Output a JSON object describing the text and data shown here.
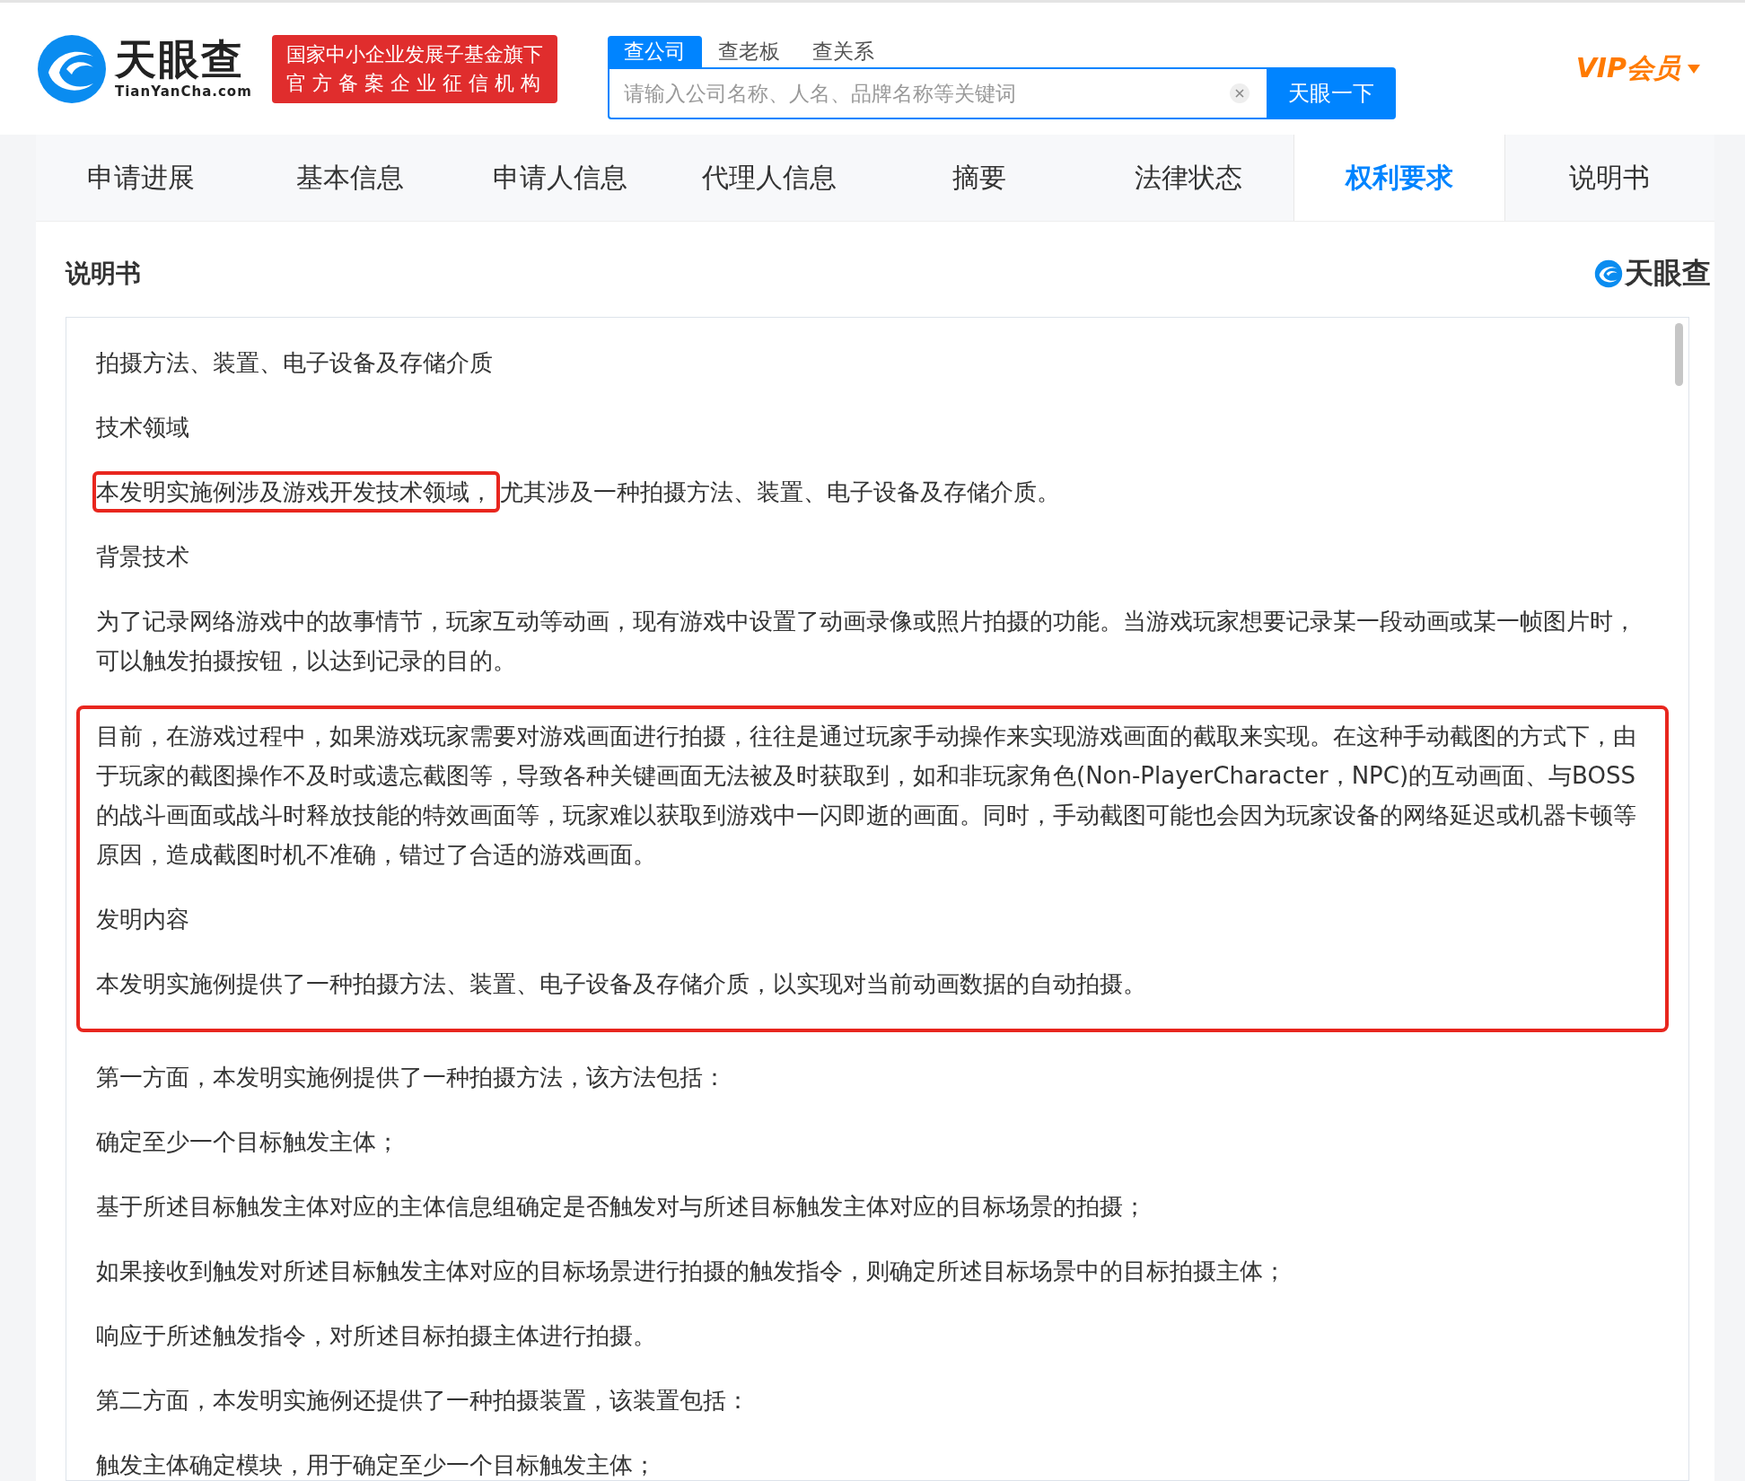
{
  "header": {
    "logo": {
      "name": "天眼查",
      "domain": "TianYanCha.com"
    },
    "badge": [
      "国家中小企业发展子基金旗下",
      "官 方 备 案 企 业 征 信 机 构"
    ],
    "search_tabs": [
      {
        "label": "查公司",
        "selected": true
      },
      {
        "label": "查老板",
        "selected": false
      },
      {
        "label": "查关系",
        "selected": false
      }
    ],
    "search": {
      "placeholder": "请输入公司名称、人名、品牌名称等关键词",
      "button": "天眼一下"
    },
    "vip": "VIP会员"
  },
  "nav_tabs": [
    {
      "label": "申请进展",
      "selected": false
    },
    {
      "label": "基本信息",
      "selected": false
    },
    {
      "label": "申请人信息",
      "selected": false
    },
    {
      "label": "代理人信息",
      "selected": false
    },
    {
      "label": "摘要",
      "selected": false
    },
    {
      "label": "法律状态",
      "selected": false
    },
    {
      "label": "权利要求",
      "selected": true
    },
    {
      "label": "说明书",
      "selected": false
    }
  ],
  "section": {
    "title": "说明书",
    "brand": "天眼查",
    "blocks": [
      {
        "kind": "paragraph",
        "text": "拍摄方法、装置、电子设备及存储介质"
      },
      {
        "kind": "paragraph",
        "text": "技术领域"
      },
      {
        "kind": "marked_paragraph",
        "marked": "本发明实施例涉及游戏开发技术领域，",
        "text": "尤其涉及一种拍摄方法、装置、电子设备及存储介质。"
      },
      {
        "kind": "paragraph",
        "text": "背景技术"
      },
      {
        "kind": "paragraph",
        "text": "为了记录网络游戏中的故事情节，玩家互动等动画，现有游戏中设置了动画录像或照片拍摄的功能。当游戏玩家想要记录某一段动画或某一帧图片时，可以触发拍摄按钮，以达到记录的目的。"
      },
      {
        "kind": "marked_group",
        "paragraphs": [
          "目前，在游戏过程中，如果游戏玩家需要对游戏画面进行拍摄，往往是通过玩家手动操作来实现游戏画面的截取来实现。在这种手动截图的方式下，由于玩家的截图操作不及时或遗忘截图等，导致各种关键画面无法被及时获取到，如和非玩家角色(Non-PlayerCharacter，NPC)的互动画面、与BOSS的战斗画面或战斗时释放技能的特效画面等，玩家难以获取到游戏中一闪即逝的画面。同时，手动截图可能也会因为玩家设备的网络延迟或机器卡顿等原因，造成截图时机不准确，错过了合适的游戏画面。",
          "发明内容",
          "本发明实施例提供了一种拍摄方法、装置、电子设备及存储介质，以实现对当前动画数据的自动拍摄。"
        ]
      },
      {
        "kind": "paragraph",
        "text": "第一方面，本发明实施例提供了一种拍摄方法，该方法包括："
      },
      {
        "kind": "paragraph",
        "text": "确定至少一个目标触发主体；"
      },
      {
        "kind": "paragraph",
        "text": "基于所述目标触发主体对应的主体信息组确定是否触发对与所述目标触发主体对应的目标场景的拍摄；"
      },
      {
        "kind": "paragraph",
        "text": "如果接收到触发对所述目标触发主体对应的目标场景进行拍摄的触发指令，则确定所述目标场景中的目标拍摄主体；"
      },
      {
        "kind": "paragraph",
        "text": "响应于所述触发指令，对所述目标拍摄主体进行拍摄。"
      },
      {
        "kind": "paragraph",
        "text": "第二方面，本发明实施例还提供了一种拍摄装置，该装置包括："
      },
      {
        "kind": "paragraph",
        "text": "触发主体确定模块，用于确定至少一个目标触发主体；"
      }
    ]
  }
}
